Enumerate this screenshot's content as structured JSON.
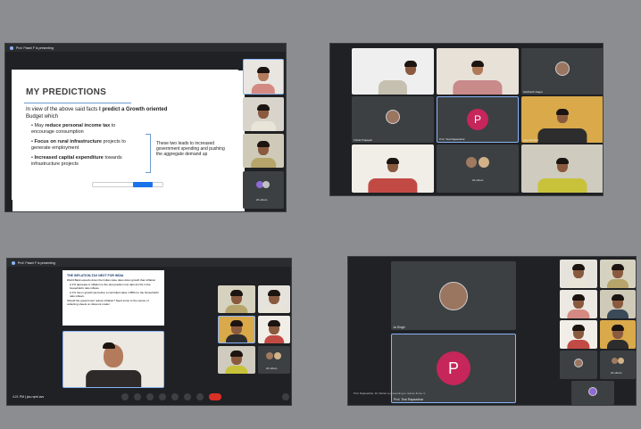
{
  "screens": {
    "top_left": {
      "presenter_bar": "Prof. Pawni F is presenting",
      "slide": {
        "title": "MY PREDICTIONS",
        "intro_start": "In view of the above said facts ",
        "intro_bold": "I predict a Growth oriented",
        "intro_end": "Budget which",
        "bullets": [
          {
            "pre": "May ",
            "bold": "reduce personal income tax",
            "post": " to encourage consumption"
          },
          {
            "pre": "",
            "bold": "Focus on rural infrastructure",
            "post": " projects to generate employment"
          },
          {
            "pre": "",
            "bold": "Increased capital expenditure",
            "post": " towards infrastructure projects"
          }
        ],
        "side_note": "These two leads to increased government spending and pushing the aggregate demand up"
      },
      "sidebar_label": "20 others"
    },
    "top_right": {
      "names": [
        "",
        "",
        "Siddharth Nagar",
        "Prof. Teal Rajasekhar",
        "Anantrupa Salva",
        "Vishal Prajapati",
        "Ajay Mandloi",
        "Harsh Gupta",
        "",
        "20 others",
        ""
      ],
      "avatar_letter": "P"
    },
    "bottom_left": {
      "presenter_bar": "Prof. Pawni F is presenting",
      "slide_heading": "THE INFLATION-TAX NEXT FOR INDIA",
      "slide_lines": [
        "World Bank expects down the Indian raise rates down growth than inflation",
        "A 1% decrease in inflation to the plot position now ratio (0.1%) in the household's ratio inflows.",
        "A 1% rise in growth (as before a controlled value 1.85%) to the household's ratio inflows.",
        "Should the government reduce inflation? Need some to the source of collecting sheets on discount model"
      ],
      "time_label": "4:21 PM | jsa-rqmf-avs",
      "other_label": "20 others"
    },
    "bottom_right": {
      "top_name": "Ja Singh",
      "avatar_letter": "P",
      "bottom_name": "Prof. Teal Rajasekhar",
      "banner": "Prof. Rajasekhar, Dr. Rehan to presenting to reduce those m",
      "others": "20 others"
    }
  }
}
